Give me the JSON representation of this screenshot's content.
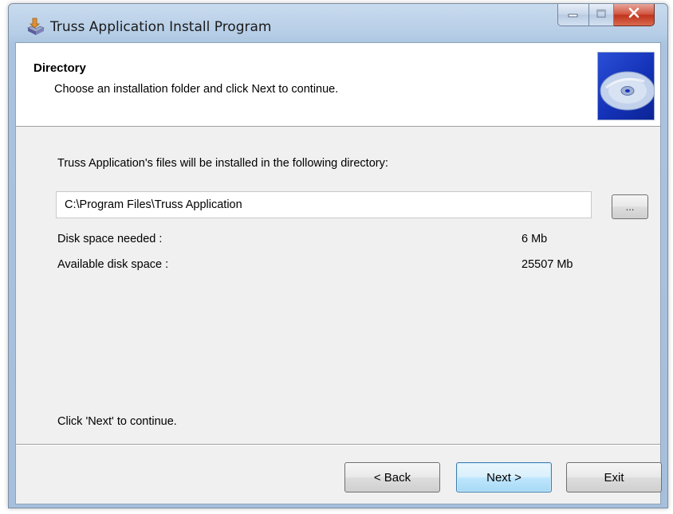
{
  "window": {
    "title": "Truss Application Install Program"
  },
  "header": {
    "title": "Directory",
    "subtitle": "Choose an installation folder and click Next to continue."
  },
  "main": {
    "intro": "Truss Application's files will be installed in the following directory:",
    "path_value": "C:\\Program Files\\Truss Application",
    "browse_label": "...",
    "disk_needed_label": "Disk space needed :",
    "disk_needed_value": "6 Mb",
    "disk_available_label": "Available disk space :",
    "disk_available_value": "25507 Mb",
    "footer": "Click 'Next' to continue."
  },
  "buttons": {
    "back": "< Back",
    "next": "Next >",
    "exit": "Exit"
  },
  "icons": {
    "app": "installer-box-icon",
    "header": "cd-disc-icon",
    "minimize": "minimize-icon",
    "maximize": "maximize-icon",
    "close": "close-icon"
  },
  "colors": {
    "titlebar": "#b5cde6",
    "close_button": "#c0331c",
    "header_image": "#1432b8",
    "dialog_bg": "#f0f0f0",
    "default_button": "#bee6fd"
  }
}
